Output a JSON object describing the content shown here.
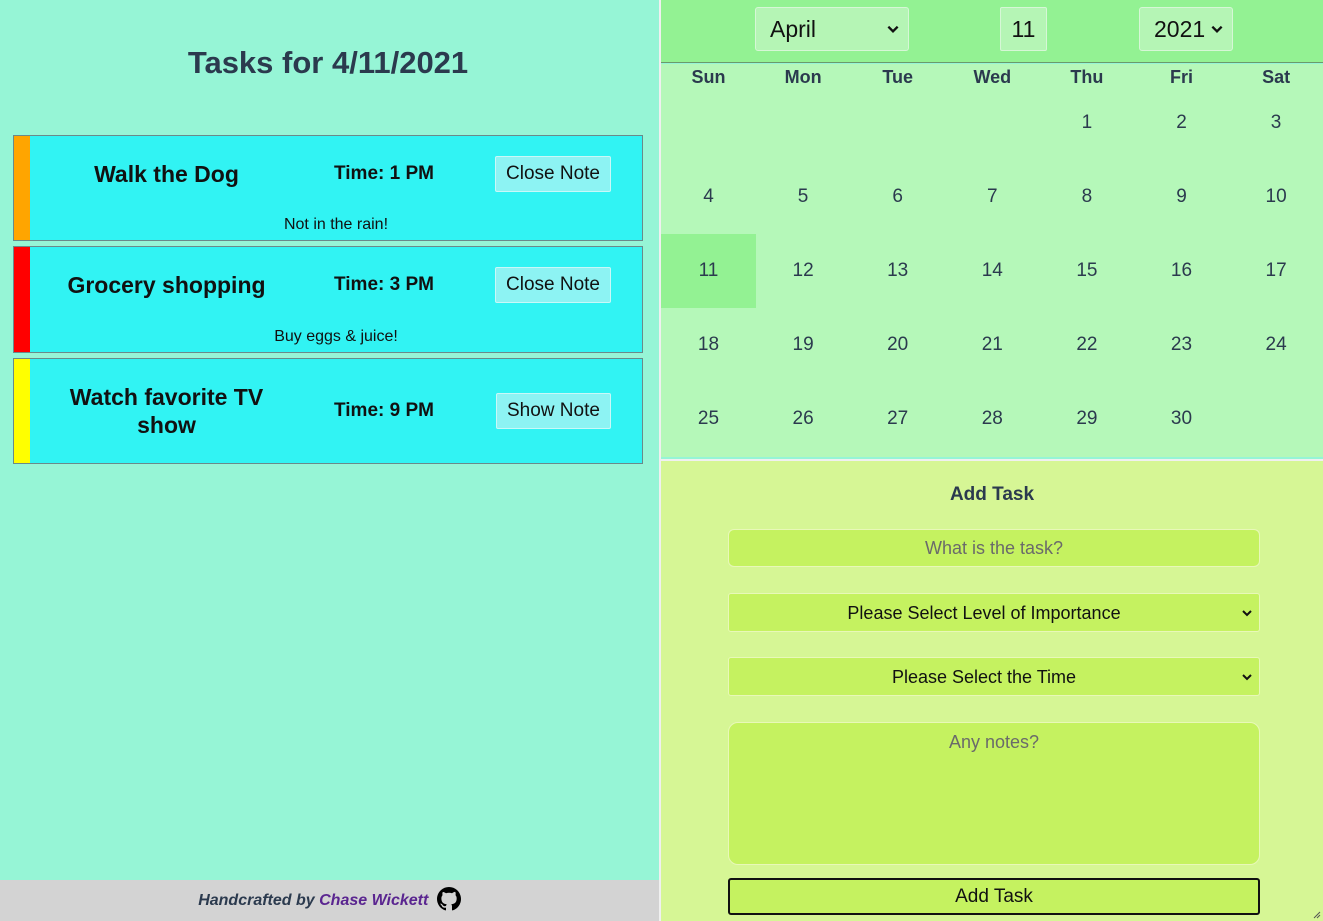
{
  "page": {
    "title": "Tasks for 4/11/2021"
  },
  "tasks": [
    {
      "name": "Walk the Dog",
      "time": "Time: 1 PM",
      "button": "Close Note",
      "note": "Not in the rain!",
      "color": "#ffa500"
    },
    {
      "name": "Grocery shopping",
      "time": "Time: 3 PM",
      "button": "Close Note",
      "note": "Buy eggs & juice!",
      "color": "#ff0000"
    },
    {
      "name": "Watch favorite TV show",
      "time": "Time: 9 PM",
      "button": "Show Note",
      "note": "",
      "color": "#ffff00"
    }
  ],
  "footer": {
    "prefix": "Handcrafted by",
    "author": "Chase Wickett",
    "icon": "github-icon"
  },
  "calendar": {
    "month": "April",
    "day": "11",
    "year": "2021",
    "weekdays": [
      "Sun",
      "Mon",
      "Tue",
      "Wed",
      "Thu",
      "Fri",
      "Sat"
    ],
    "days": [
      "1",
      "2",
      "3",
      "4",
      "5",
      "6",
      "7",
      "8",
      "9",
      "10",
      "11",
      "12",
      "13",
      "14",
      "15",
      "16",
      "17",
      "18",
      "19",
      "20",
      "21",
      "22",
      "23",
      "24",
      "25",
      "26",
      "27",
      "28",
      "29",
      "30"
    ],
    "first_weekday_index": 4,
    "selected_day": "11"
  },
  "add_task": {
    "title": "Add Task",
    "task_placeholder": "What is the task?",
    "importance_select": "Please Select Level of Importance",
    "time_select": "Please Select the Time",
    "notes_placeholder": "Any notes?",
    "submit_label": "Add Task"
  },
  "colors": {
    "left_bg": "#96f5d6",
    "task_bg": "#31f3f3",
    "calendar_header": "#93f293",
    "calendar_body": "#b5f8b9",
    "add_panel": "#d6f695",
    "field_bg": "#c5f260"
  }
}
